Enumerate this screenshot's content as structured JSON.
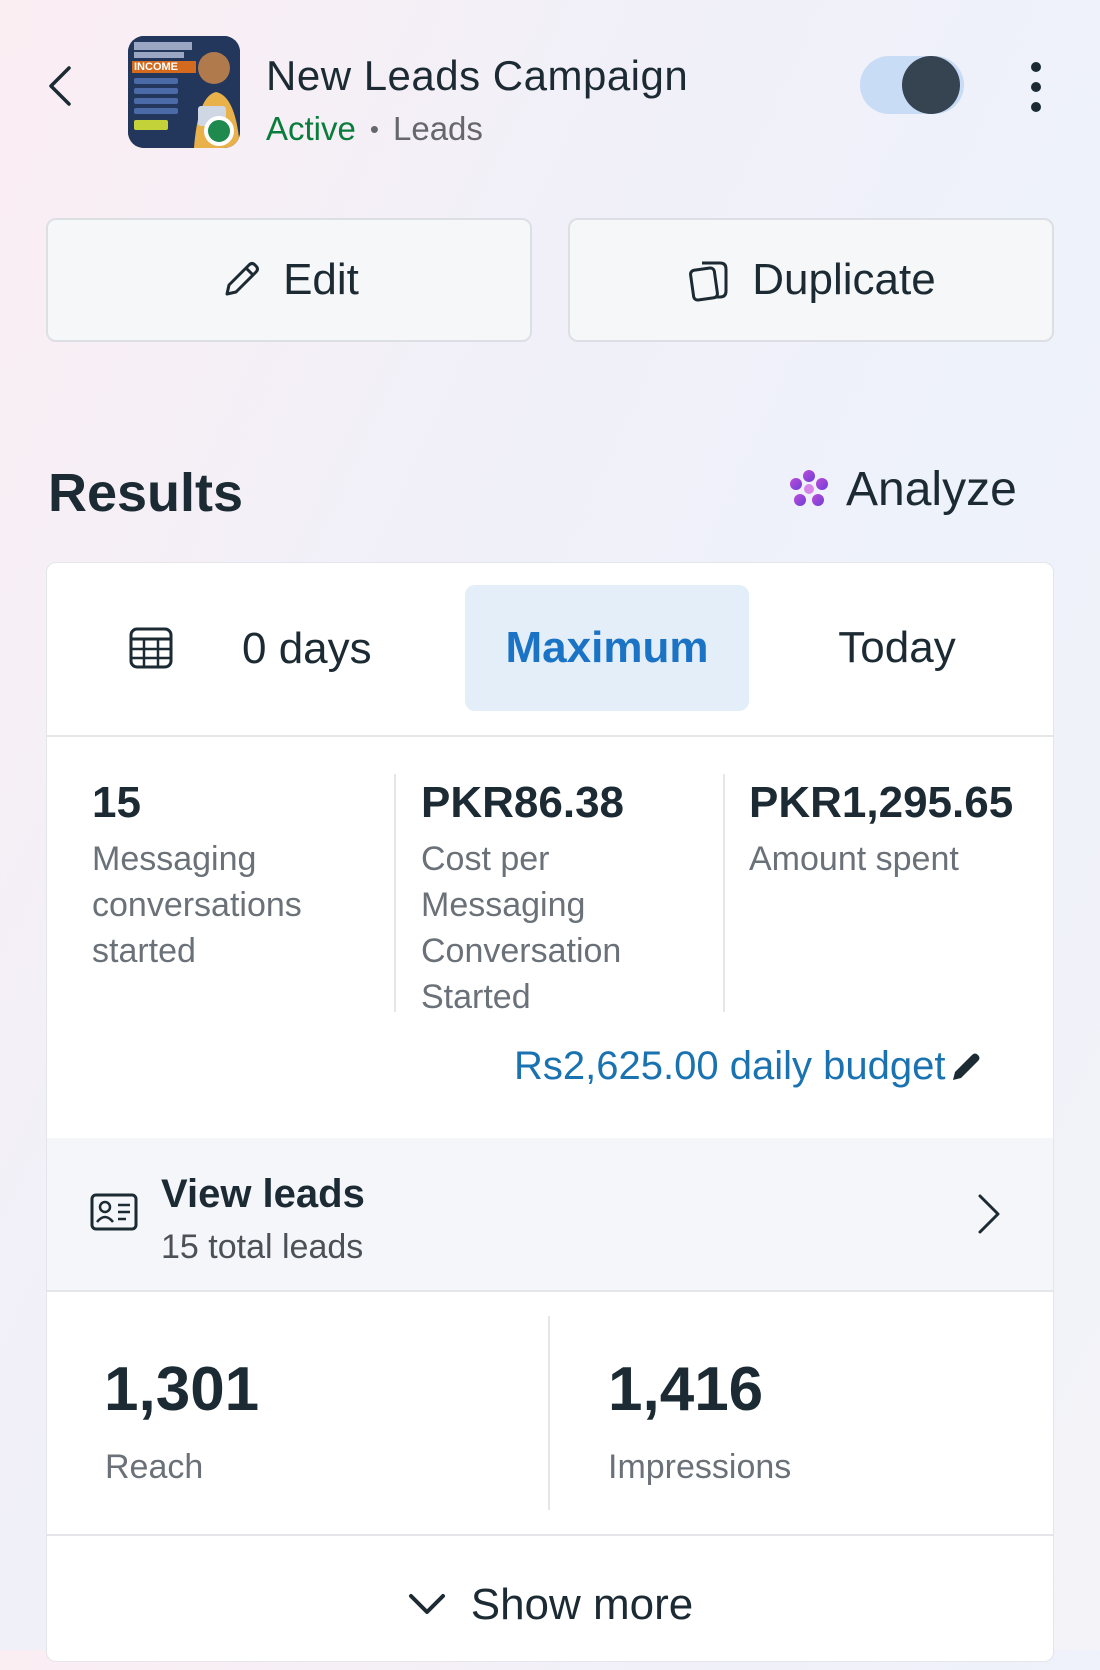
{
  "header": {
    "title": "New Leads Campaign",
    "status": "Active",
    "separator": "•",
    "objective": "Leads",
    "toggle_on": true,
    "thumbnail_text": "INCOME"
  },
  "actions": {
    "edit_label": "Edit",
    "duplicate_label": "Duplicate"
  },
  "results": {
    "title": "Results",
    "analyze_label": "Analyze"
  },
  "date_range": {
    "days_label": "0 days",
    "tabs": [
      {
        "label": "Maximum",
        "selected": true
      },
      {
        "label": "Today",
        "selected": false
      }
    ]
  },
  "metrics": [
    {
      "value": "15",
      "label": "Messaging conversations started"
    },
    {
      "value": "PKR86.38",
      "label": "Cost per Messaging Conversation Started"
    },
    {
      "value": "PKR1,295.65",
      "label": "Amount spent"
    }
  ],
  "budget": {
    "label": "Rs2,625.00 daily budget"
  },
  "leads": {
    "title": "View leads",
    "subtitle": "15 total leads"
  },
  "reach": {
    "value": "1,301",
    "label": "Reach"
  },
  "impressions": {
    "value": "1,416",
    "label": "Impressions"
  },
  "show_more_label": "Show more",
  "colors": {
    "accent_blue": "#1a73c4",
    "active_green": "#0a7d3c",
    "toggle_track": "#c9dcf6",
    "toggle_knob": "#364350"
  }
}
